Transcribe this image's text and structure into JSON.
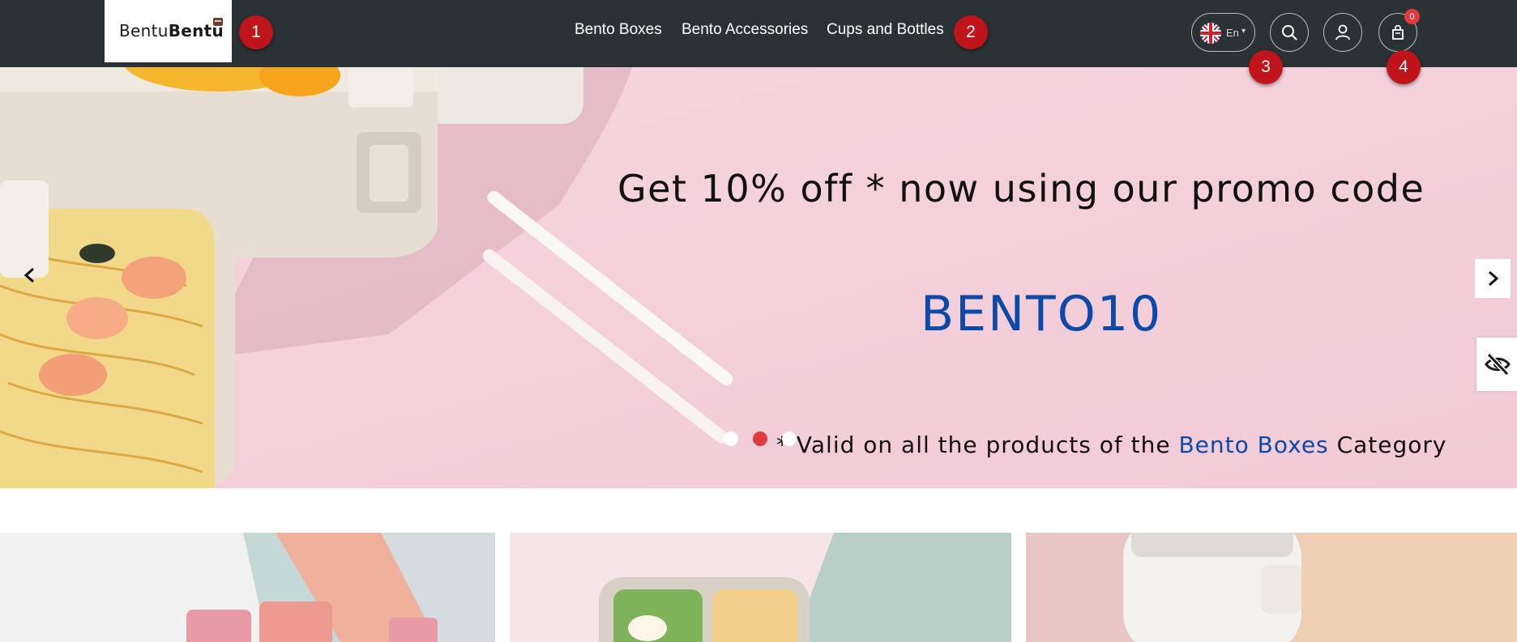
{
  "header": {
    "logo": {
      "part1": "Bentu",
      "part2": "Bentu"
    },
    "nav": [
      "Bento Boxes",
      "Bento Accessories",
      "Cups and Bottles"
    ],
    "language": {
      "code": "En",
      "flag_icon": "uk-flag-icon"
    },
    "icons": [
      "search-icon",
      "user-icon",
      "bag-icon"
    ],
    "cart_count": "0"
  },
  "markers": [
    "1",
    "2",
    "3",
    "4"
  ],
  "hero": {
    "promo_text": "Get 10% off * now using our promo code",
    "promo_code": "BENTO10",
    "valid_prefix": "* Valid on all the products of the",
    "valid_link": "Bento Boxes",
    "valid_suffix": "Category",
    "slide_count": 3,
    "active_slide": 2
  },
  "colors": {
    "header_bg": "#2b3236",
    "hero_bg": "#f3cfd9",
    "accent_blue": "#0b4aa8",
    "marker_red": "#c0141b",
    "active_dot": "#e0393e"
  }
}
